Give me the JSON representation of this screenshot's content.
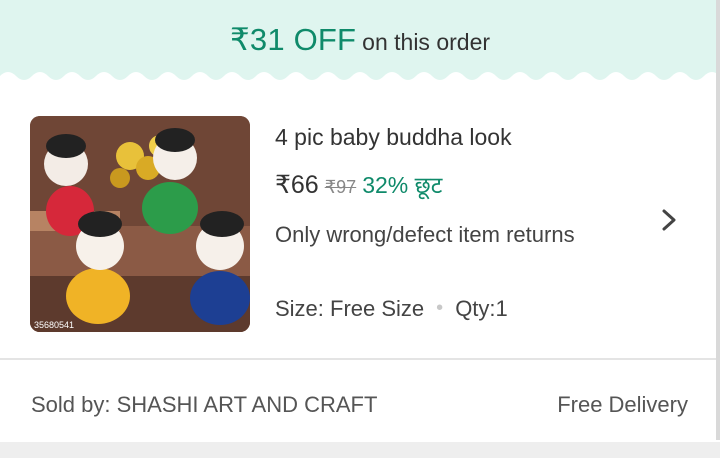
{
  "offer_banner": {
    "amount": "₹31 OFF",
    "suffix": "on this order",
    "background": "#dff5ef",
    "accent": "#0f8a6a"
  },
  "product": {
    "title": "4 pic baby buddha look",
    "price": "₹66",
    "mrp": "₹97",
    "discount": "32% छूट",
    "return_policy": "Only wrong/defect item returns",
    "size_label": "Size: Free Size",
    "qty_label": "Qty:1",
    "image_watermark": "35680541",
    "icons": {
      "navigate": "chevron-right-icon",
      "separator": "dot"
    }
  },
  "seller": {
    "sold_by": "Sold by: SHASHI ART AND CRAFT",
    "delivery": "Free Delivery"
  }
}
